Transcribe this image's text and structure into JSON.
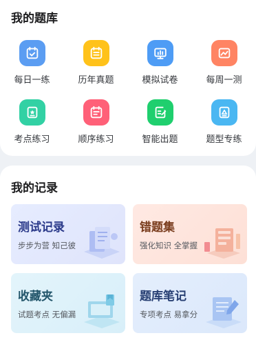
{
  "question_bank": {
    "title": "我的题库",
    "items": [
      {
        "label": "每日一练",
        "color": "#5b9df2",
        "icon": "calendar-check-icon"
      },
      {
        "label": "历年真题",
        "color": "#ffc21a",
        "icon": "calendar-list-icon"
      },
      {
        "label": "模拟试卷",
        "color": "#4e9cf5",
        "icon": "chart-board-icon"
      },
      {
        "label": "每周一测",
        "color": "#ff8463",
        "icon": "trend-image-icon"
      },
      {
        "label": "考点练习",
        "color": "#32d1a4",
        "icon": "star-card-icon"
      },
      {
        "label": "顺序练习",
        "color": "#ff6078",
        "icon": "calendar-lines-icon"
      },
      {
        "label": "智能出题",
        "color": "#1fcf6e",
        "icon": "doc-pen-icon"
      },
      {
        "label": "题型专练",
        "color": "#4ab7f2",
        "icon": "triangle-card-icon"
      }
    ]
  },
  "records": {
    "title": "我的记录",
    "cards": [
      {
        "title": "测试记录",
        "subtitle": "步步为营 知己彼",
        "accent": "#8fa4ef",
        "icon": "test-record-illustration"
      },
      {
        "title": "错题集",
        "subtitle": "强化知识 全掌握",
        "accent": "#f3a58a",
        "icon": "wrong-set-illustration"
      },
      {
        "title": "收藏夹",
        "subtitle": "试题考点 无偏漏",
        "accent": "#7fcbe6",
        "icon": "favorites-illustration"
      },
      {
        "title": "题库笔记",
        "subtitle": "专项考点 易拿分",
        "accent": "#8fb3ef",
        "icon": "notes-illustration"
      }
    ]
  }
}
